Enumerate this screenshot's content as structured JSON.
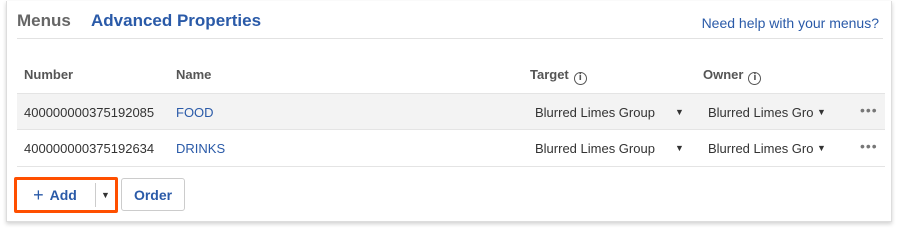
{
  "tabs": {
    "menus": "Menus",
    "advanced": "Advanced Properties"
  },
  "help_link": "Need help with your menus?",
  "table": {
    "columns": {
      "number": "Number",
      "name": "Name",
      "target": "Target",
      "owner": "Owner"
    },
    "info_icon_glyph": "i",
    "caret_glyph": "▼",
    "more_glyph": "•••",
    "rows": [
      {
        "number": "400000000375192085",
        "name": "FOOD",
        "target": "Blurred Limes Group",
        "owner": "Blurred Limes Group"
      },
      {
        "number": "400000000375192634",
        "name": "DRINKS",
        "target": "Blurred Limes Group",
        "owner": "Blurred Limes Group"
      }
    ]
  },
  "actions": {
    "add_plus": "+",
    "add_label": "Add",
    "order_label": "Order"
  },
  "colors": {
    "link": "#2a5aa8",
    "highlight": "#ff4f00",
    "row_hover": "#f3f3f3"
  },
  "icons": {
    "info": "info-circle-icon",
    "caret": "caret-down-icon",
    "more": "more-horizontal-icon",
    "plus": "plus-icon"
  }
}
